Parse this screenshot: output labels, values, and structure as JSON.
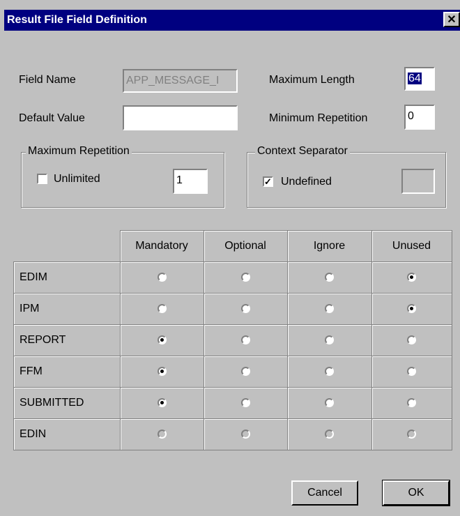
{
  "window": {
    "title": "Result File Field Definition",
    "close_glyph": "✕"
  },
  "fields": {
    "field_name": {
      "label": "Field Name",
      "value": "APP_MESSAGE_I"
    },
    "default_value": {
      "label": "Default Value",
      "value": ""
    },
    "maximum_length": {
      "label": "Maximum Length",
      "value": "64"
    },
    "minimum_repetition": {
      "label": "Minimum Repetition",
      "value": "0"
    }
  },
  "maximum_repetition": {
    "title": "Maximum Repetition",
    "checkbox_label": "Unlimited",
    "checked": false,
    "value": "1"
  },
  "context_separator": {
    "title": "Context Separator",
    "checkbox_label": "Undefined",
    "checked": true,
    "value": ""
  },
  "grid": {
    "columns": [
      "Mandatory",
      "Optional",
      "Ignore",
      "Unused"
    ],
    "rows": [
      {
        "name": "EDIM",
        "selected": 3,
        "disabled": false
      },
      {
        "name": "IPM",
        "selected": 3,
        "disabled": false
      },
      {
        "name": "REPORT",
        "selected": 0,
        "disabled": false
      },
      {
        "name": "FFM",
        "selected": 0,
        "disabled": false
      },
      {
        "name": "SUBMITTED",
        "selected": 0,
        "disabled": false
      },
      {
        "name": "EDIN",
        "selected": -1,
        "disabled": true
      }
    ]
  },
  "buttons": {
    "cancel": "Cancel",
    "ok": "OK"
  },
  "colors": {
    "titlebar": "#000080",
    "face": "#c0c0c0"
  }
}
